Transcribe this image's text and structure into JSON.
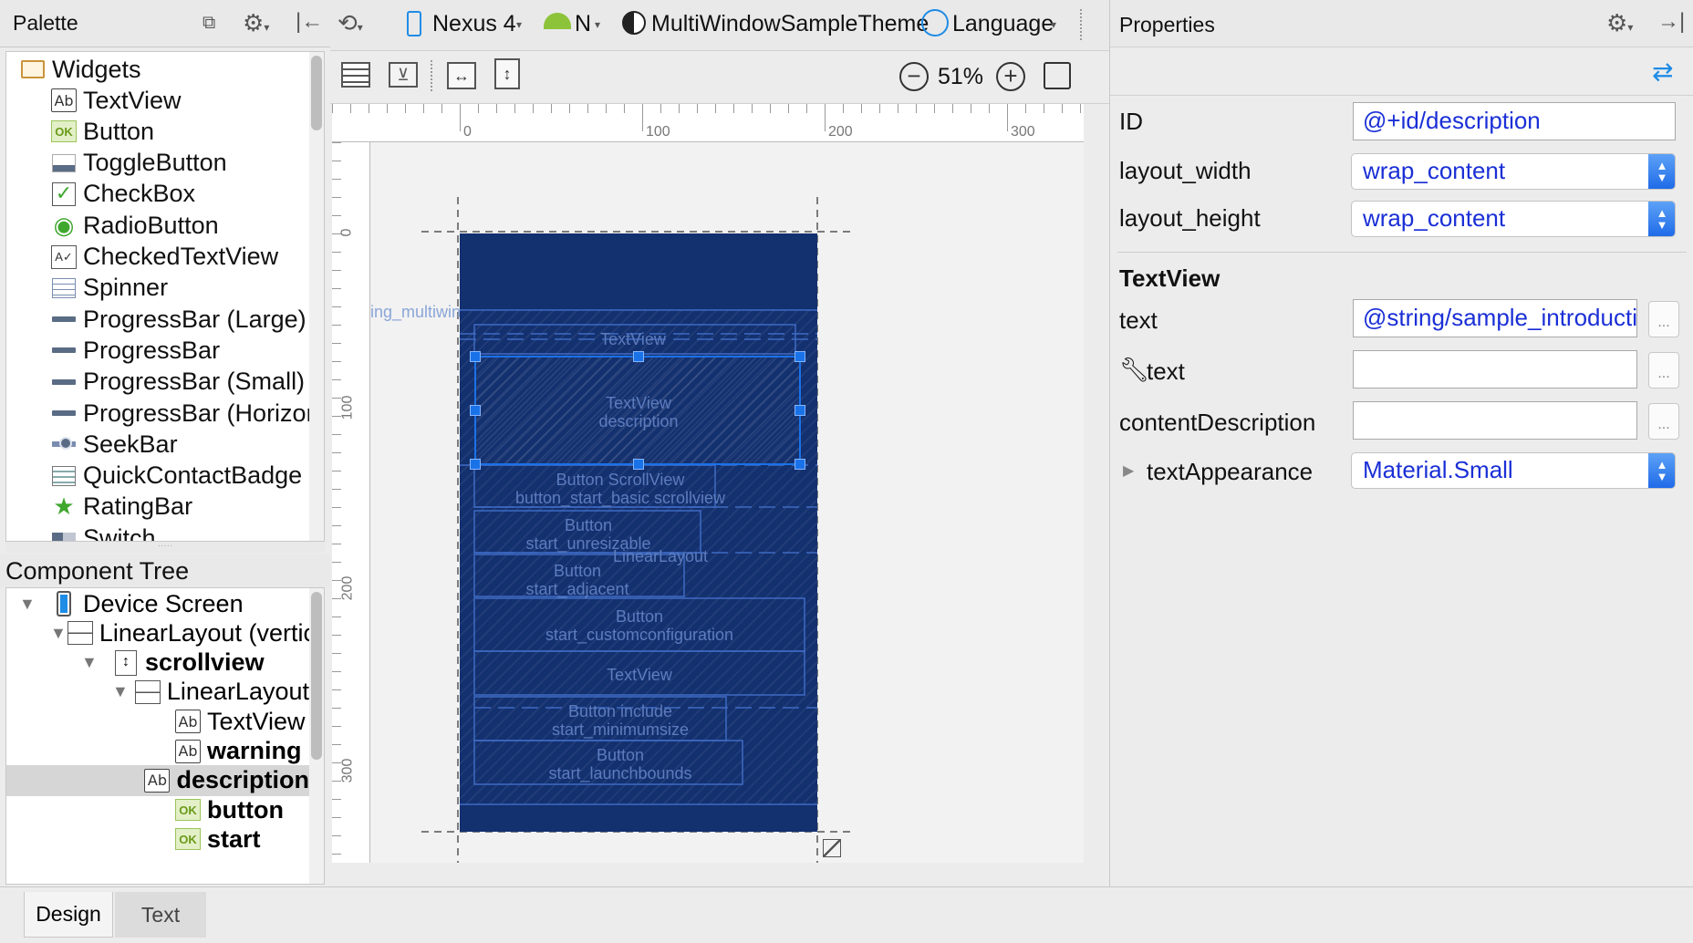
{
  "palette": {
    "title": "Palette",
    "group": "Widgets",
    "items": [
      {
        "label": "TextView",
        "icon": "textview-icon",
        "glyph": "Ab"
      },
      {
        "label": "Button",
        "icon": "button-icon",
        "glyph": "OK"
      },
      {
        "label": "ToggleButton",
        "icon": "togglebutton-icon",
        "glyph": ""
      },
      {
        "label": "CheckBox",
        "icon": "checkbox-icon",
        "glyph": "✓"
      },
      {
        "label": "RadioButton",
        "icon": "radiobutton-icon",
        "glyph": "◉"
      },
      {
        "label": "CheckedTextView",
        "icon": "checkedtextview-icon",
        "glyph": "A✓"
      },
      {
        "label": "Spinner",
        "icon": "spinner-icon",
        "glyph": ""
      },
      {
        "label": "ProgressBar (Large)",
        "icon": "progressbar-icon",
        "glyph": ""
      },
      {
        "label": "ProgressBar",
        "icon": "progressbar-icon",
        "glyph": ""
      },
      {
        "label": "ProgressBar (Small)",
        "icon": "progressbar-icon",
        "glyph": ""
      },
      {
        "label": "ProgressBar (Horizontal)",
        "icon": "progressbar-icon",
        "glyph": ""
      },
      {
        "label": "SeekBar",
        "icon": "seekbar-icon",
        "glyph": ""
      },
      {
        "label": "QuickContactBadge",
        "icon": "quickcontactbadge-icon",
        "glyph": ""
      },
      {
        "label": "RatingBar",
        "icon": "ratingbar-icon",
        "glyph": "★"
      },
      {
        "label": "Switch",
        "icon": "switch-icon",
        "glyph": ""
      }
    ]
  },
  "component_tree": {
    "title": "Component Tree",
    "items": [
      {
        "label": "Device Screen",
        "bold": false,
        "indent": 0,
        "icon": "device-icon",
        "triangle": true
      },
      {
        "label": "LinearLayout (vertical)",
        "bold": false,
        "indent": 1,
        "icon": "linearlayout-icon",
        "triangle": true
      },
      {
        "label": "scrollview",
        "bold": true,
        "indent": 2,
        "icon": "scrollview-icon",
        "triangle": true
      },
      {
        "label": "LinearLayout",
        "bold": false,
        "indent": 3,
        "icon": "linearlayout-icon",
        "triangle": true
      },
      {
        "label": "TextView",
        "bold": false,
        "indent": 4,
        "icon": "textview-icon",
        "triangle": false
      },
      {
        "label": "warning",
        "bold": true,
        "indent": 4,
        "icon": "textview-icon",
        "triangle": false
      },
      {
        "label": "description",
        "bold": true,
        "indent": 4,
        "icon": "textview-icon",
        "triangle": false,
        "selected": true
      },
      {
        "label": "button",
        "bold": true,
        "indent": 4,
        "icon": "button-icon",
        "triangle": false
      },
      {
        "label": "start",
        "bold": true,
        "indent": 4,
        "icon": "button-icon",
        "triangle": false
      }
    ]
  },
  "toolbar": {
    "device": "Nexus 4",
    "api": "N",
    "theme": "MultiWindowSampleTheme",
    "language": "Language",
    "zoom": "51%"
  },
  "ruler": {
    "h_ticks": [
      "0",
      "100",
      "200",
      "300"
    ],
    "v_ticks": [
      "0",
      "100",
      "200",
      "300"
    ]
  },
  "device_preview": {
    "overflow_label": "ing_multiwindow_disabled",
    "labels": [
      {
        "text": "TextView"
      },
      {
        "text": "TextView\ndescription"
      },
      {
        "text": "Button ScrollView\nbutton_start_basic scrollview"
      },
      {
        "text": "Button\nstart_unresizable"
      },
      {
        "text": "LinearLayout"
      },
      {
        "text": "Button\nstart_adjacent"
      },
      {
        "text": "Button\nstart_customconfiguration"
      },
      {
        "text": "TextView"
      },
      {
        "text": "Button include\nstart_minimumsize"
      },
      {
        "text": "Button\nstart_launchbounds"
      }
    ]
  },
  "properties": {
    "title": "Properties",
    "id_label": "ID",
    "id_value": "@+id/description",
    "layout_width_label": "layout_width",
    "layout_width_value": "wrap_content",
    "layout_height_label": "layout_height",
    "layout_height_value": "wrap_content",
    "section": "TextView",
    "text_label": "text",
    "text_value": "@string/sample_introduction",
    "tools_text_label": "text",
    "tools_text_value": "",
    "content_description_label": "contentDescription",
    "content_description_value": "",
    "text_appearance_label": "textAppearance",
    "text_appearance_value": "Material.Small",
    "ellipsis": "..."
  },
  "tabs": [
    {
      "label": "Design",
      "active": true
    },
    {
      "label": "Text",
      "active": false
    }
  ],
  "colors": {
    "device_bg": "#13306f",
    "selection": "#1a72e8",
    "value_text": "#1a2fd6"
  }
}
